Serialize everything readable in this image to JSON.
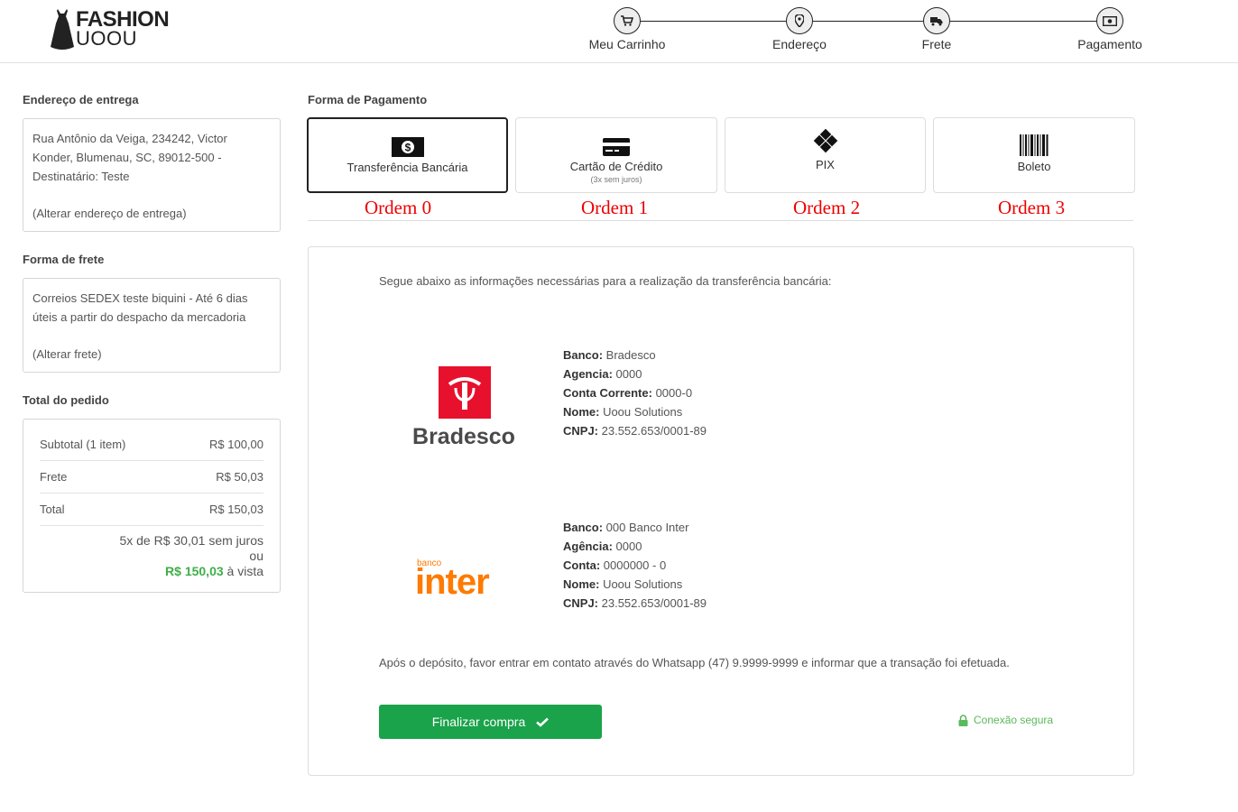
{
  "brand": {
    "line1": "FASHION",
    "line2": "UOOU"
  },
  "steps": [
    {
      "label": "Meu Carrinho",
      "icon": "cart-icon"
    },
    {
      "label": "Endereço",
      "icon": "map-pin-icon"
    },
    {
      "label": "Frete",
      "icon": "truck-icon"
    },
    {
      "label": "Pagamento",
      "icon": "money-icon"
    }
  ],
  "delivery": {
    "title": "Endereço de entrega",
    "line1": "Rua Antônio da Veiga, 234242, Victor",
    "line2": "Konder, Blumenau, SC, 89012-500 -",
    "line3": "Destinatário: Teste",
    "change": "(Alterar endereço de entrega)"
  },
  "shipping": {
    "title": "Forma de frete",
    "line1": "Correios SEDEX teste biquini - Até 6 dias",
    "line2": "úteis a partir do despacho da mercadoria",
    "change": "(Alterar frete)"
  },
  "order": {
    "title": "Total do pedido",
    "rows": [
      {
        "label": "Subtotal (1 item)",
        "value": "R$ 100,00"
      },
      {
        "label": "Frete",
        "value": "R$ 50,03"
      },
      {
        "label": "Total",
        "value": "R$ 150,03"
      }
    ],
    "installments": "5x de R$ 30,01 sem juros",
    "or": "ou",
    "cash_value": "R$ 150,03",
    "cash_suffix": " à vista"
  },
  "payment": {
    "title": "Forma de Pagamento",
    "methods": [
      {
        "label": "Transferência Bancária",
        "sub": "",
        "order": "Ordem 0"
      },
      {
        "label": "Cartão de Crédito",
        "sub": "(3x sem juros)",
        "order": "Ordem 1"
      },
      {
        "label": "PIX",
        "sub": "",
        "order": "Ordem 2"
      },
      {
        "label": "Boleto",
        "sub": "",
        "order": "Ordem 3"
      }
    ]
  },
  "transfer": {
    "intro": "Segue abaixo as informações necessárias para a realização da transferência bancária:",
    "banks": [
      {
        "logo": "Bradesco",
        "fields": [
          {
            "k": "Banco:",
            "v": " Bradesco"
          },
          {
            "k": "Agencia:",
            "v": " 0000"
          },
          {
            "k": "Conta Corrente:",
            "v": " 0000-0"
          },
          {
            "k": "Nome:",
            "v": " Uoou Solutions"
          },
          {
            "k": "CNPJ:",
            "v": " 23.552.653/0001-89"
          }
        ]
      },
      {
        "logo_top": "banco",
        "logo": "inter",
        "fields": [
          {
            "k": "Banco:",
            "v": " 000 Banco Inter"
          },
          {
            "k": "Agência:",
            "v": " 0000"
          },
          {
            "k": "Conta:",
            "v": " 0000000 - 0"
          },
          {
            "k": "Nome:",
            "v": " Uoou Solutions"
          },
          {
            "k": "CNPJ:",
            "v": " 23.552.653/0001-89"
          }
        ]
      }
    ],
    "after": "Após o depósito, favor entrar em contato  através do Whatsapp (47) 9.9999-9999 e informar que a transação foi efetuada."
  },
  "actions": {
    "finalize": "Finalizar compra",
    "secure": "Conexão segura"
  },
  "colors": {
    "accent": "#1aa34a",
    "highlight": "#3fae49",
    "annotation": "#e00000",
    "bradesco": "#e8112d",
    "inter": "#ff7a00"
  }
}
